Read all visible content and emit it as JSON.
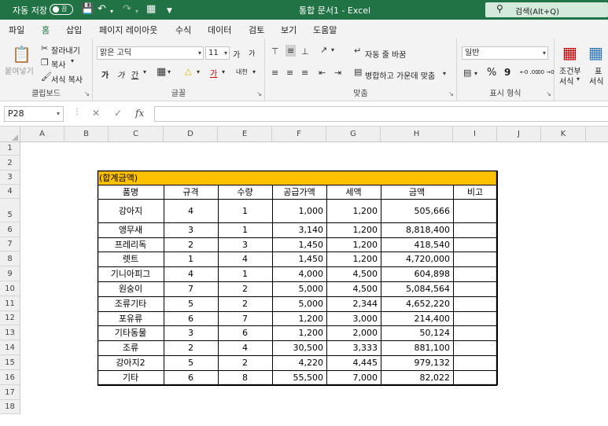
{
  "titlebar": {
    "autosave_label": "자동 저장",
    "autosave_state": "끔",
    "title": "통합 문서1 - Excel",
    "search_placeholder": "검색(Alt+Q)"
  },
  "menu_tabs": [
    "파일",
    "홈",
    "삽입",
    "페이지 레이아웃",
    "수식",
    "데이터",
    "검토",
    "보기",
    "도움말"
  ],
  "active_tab": "홈",
  "ribbon": {
    "clipboard": {
      "paste": "붙여넣기",
      "cut": "잘라내기",
      "copy": "복사",
      "format_painter": "서식 복사",
      "label": "클립보드"
    },
    "font": {
      "font_name": "맑은 고딕",
      "font_size": "11",
      "grow": "가",
      "shrink": "가",
      "bold": "가",
      "italic": "가",
      "underline": "간",
      "phonetic": "내천",
      "label": "글꼴"
    },
    "alignment": {
      "wrap": "자동 줄 바꿈",
      "merge": "병합하고 가운데 맞춤",
      "label": "맞춤"
    },
    "number": {
      "format": "일반",
      "percent": "%",
      "comma": "9",
      "inc_decimal": "←0 .00",
      "dec_decimal": ".00 →0",
      "label": "표시 형식"
    },
    "styles": {
      "conditional": "조건부",
      "conditional2": "서식",
      "table": "표",
      "table2": "서식"
    }
  },
  "formula_bar": {
    "name_box": "P28",
    "fx": "fx",
    "formula": ""
  },
  "columns": [
    "A",
    "B",
    "C",
    "D",
    "E",
    "F",
    "G",
    "H",
    "I",
    "J",
    "K"
  ],
  "rows": [
    "1",
    "2",
    "3",
    "4",
    "5",
    "6",
    "7",
    "8",
    "9",
    "10",
    "11",
    "12",
    "13",
    "14",
    "15",
    "16",
    "17",
    "18"
  ],
  "table": {
    "title": "(합계금액)",
    "title_fill": "#ffc000",
    "headers": [
      "품명",
      "규격",
      "수량",
      "공급가액",
      "세액",
      "금액",
      "비고"
    ],
    "data": [
      [
        "강아지",
        "4",
        "1",
        "1,000",
        "1,200",
        "505,666",
        ""
      ],
      [
        "앵무새",
        "3",
        "1",
        "3,140",
        "1,200",
        "8,818,400",
        ""
      ],
      [
        "프레리독",
        "2",
        "3",
        "1,450",
        "1,200",
        "418,540",
        ""
      ],
      [
        "렛트",
        "1",
        "4",
        "1,450",
        "1,200",
        "4,720,000",
        ""
      ],
      [
        "기니아피그",
        "4",
        "1",
        "4,000",
        "4,500",
        "604,898",
        ""
      ],
      [
        "원숭이",
        "7",
        "2",
        "5,000",
        "4,500",
        "5,084,564",
        ""
      ],
      [
        "조류기타",
        "5",
        "2",
        "5,000",
        "2,344",
        "4,652,220",
        ""
      ],
      [
        "포유류",
        "6",
        "7",
        "1,200",
        "3,000",
        "214,400",
        ""
      ],
      [
        "기타동물",
        "3",
        "6",
        "1,200",
        "2,000",
        "50,124",
        ""
      ],
      [
        "조류",
        "2",
        "4",
        "30,500",
        "3,333",
        "881,100",
        ""
      ],
      [
        "강아지2",
        "5",
        "2",
        "4,220",
        "4,445",
        "979,132",
        ""
      ],
      [
        "기타",
        "6",
        "8",
        "55,500",
        "7,000",
        "82,022",
        ""
      ]
    ]
  }
}
